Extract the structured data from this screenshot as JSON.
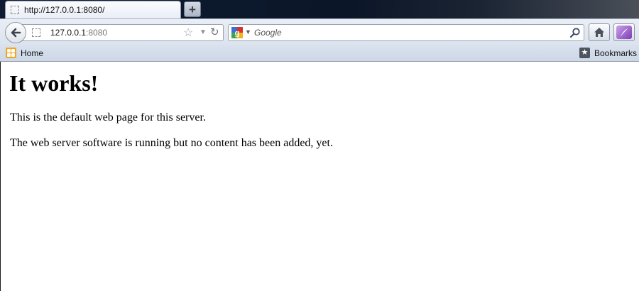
{
  "window": {
    "tab_title": "http://127.0.0.1:8080/",
    "new_tab_label": "+"
  },
  "navbar": {
    "url_host": "127.0.0.1",
    "url_port": ":8080",
    "search_placeholder": "Google"
  },
  "bookmarks": {
    "home_label": "Home",
    "bookmarks_label": "Bookmarks"
  },
  "page": {
    "heading": "It works!",
    "paragraph1": "This is the default web page for this server.",
    "paragraph2": "The web server software is running but no content has been added, yet."
  },
  "icons": {
    "back": "back-arrow-icon",
    "star": "bookmark-star-icon",
    "reload": "reload-icon",
    "search_engine": "google-icon",
    "search_go": "magnifier-icon",
    "home": "home-icon",
    "addon": "quill-icon"
  },
  "colors": {
    "tabstrip_dark": "#0e1c33",
    "toolbar": "#dbe3ee",
    "bookmarks_bar": "#cdd7e5",
    "addon_accent": "#7d3db8"
  }
}
